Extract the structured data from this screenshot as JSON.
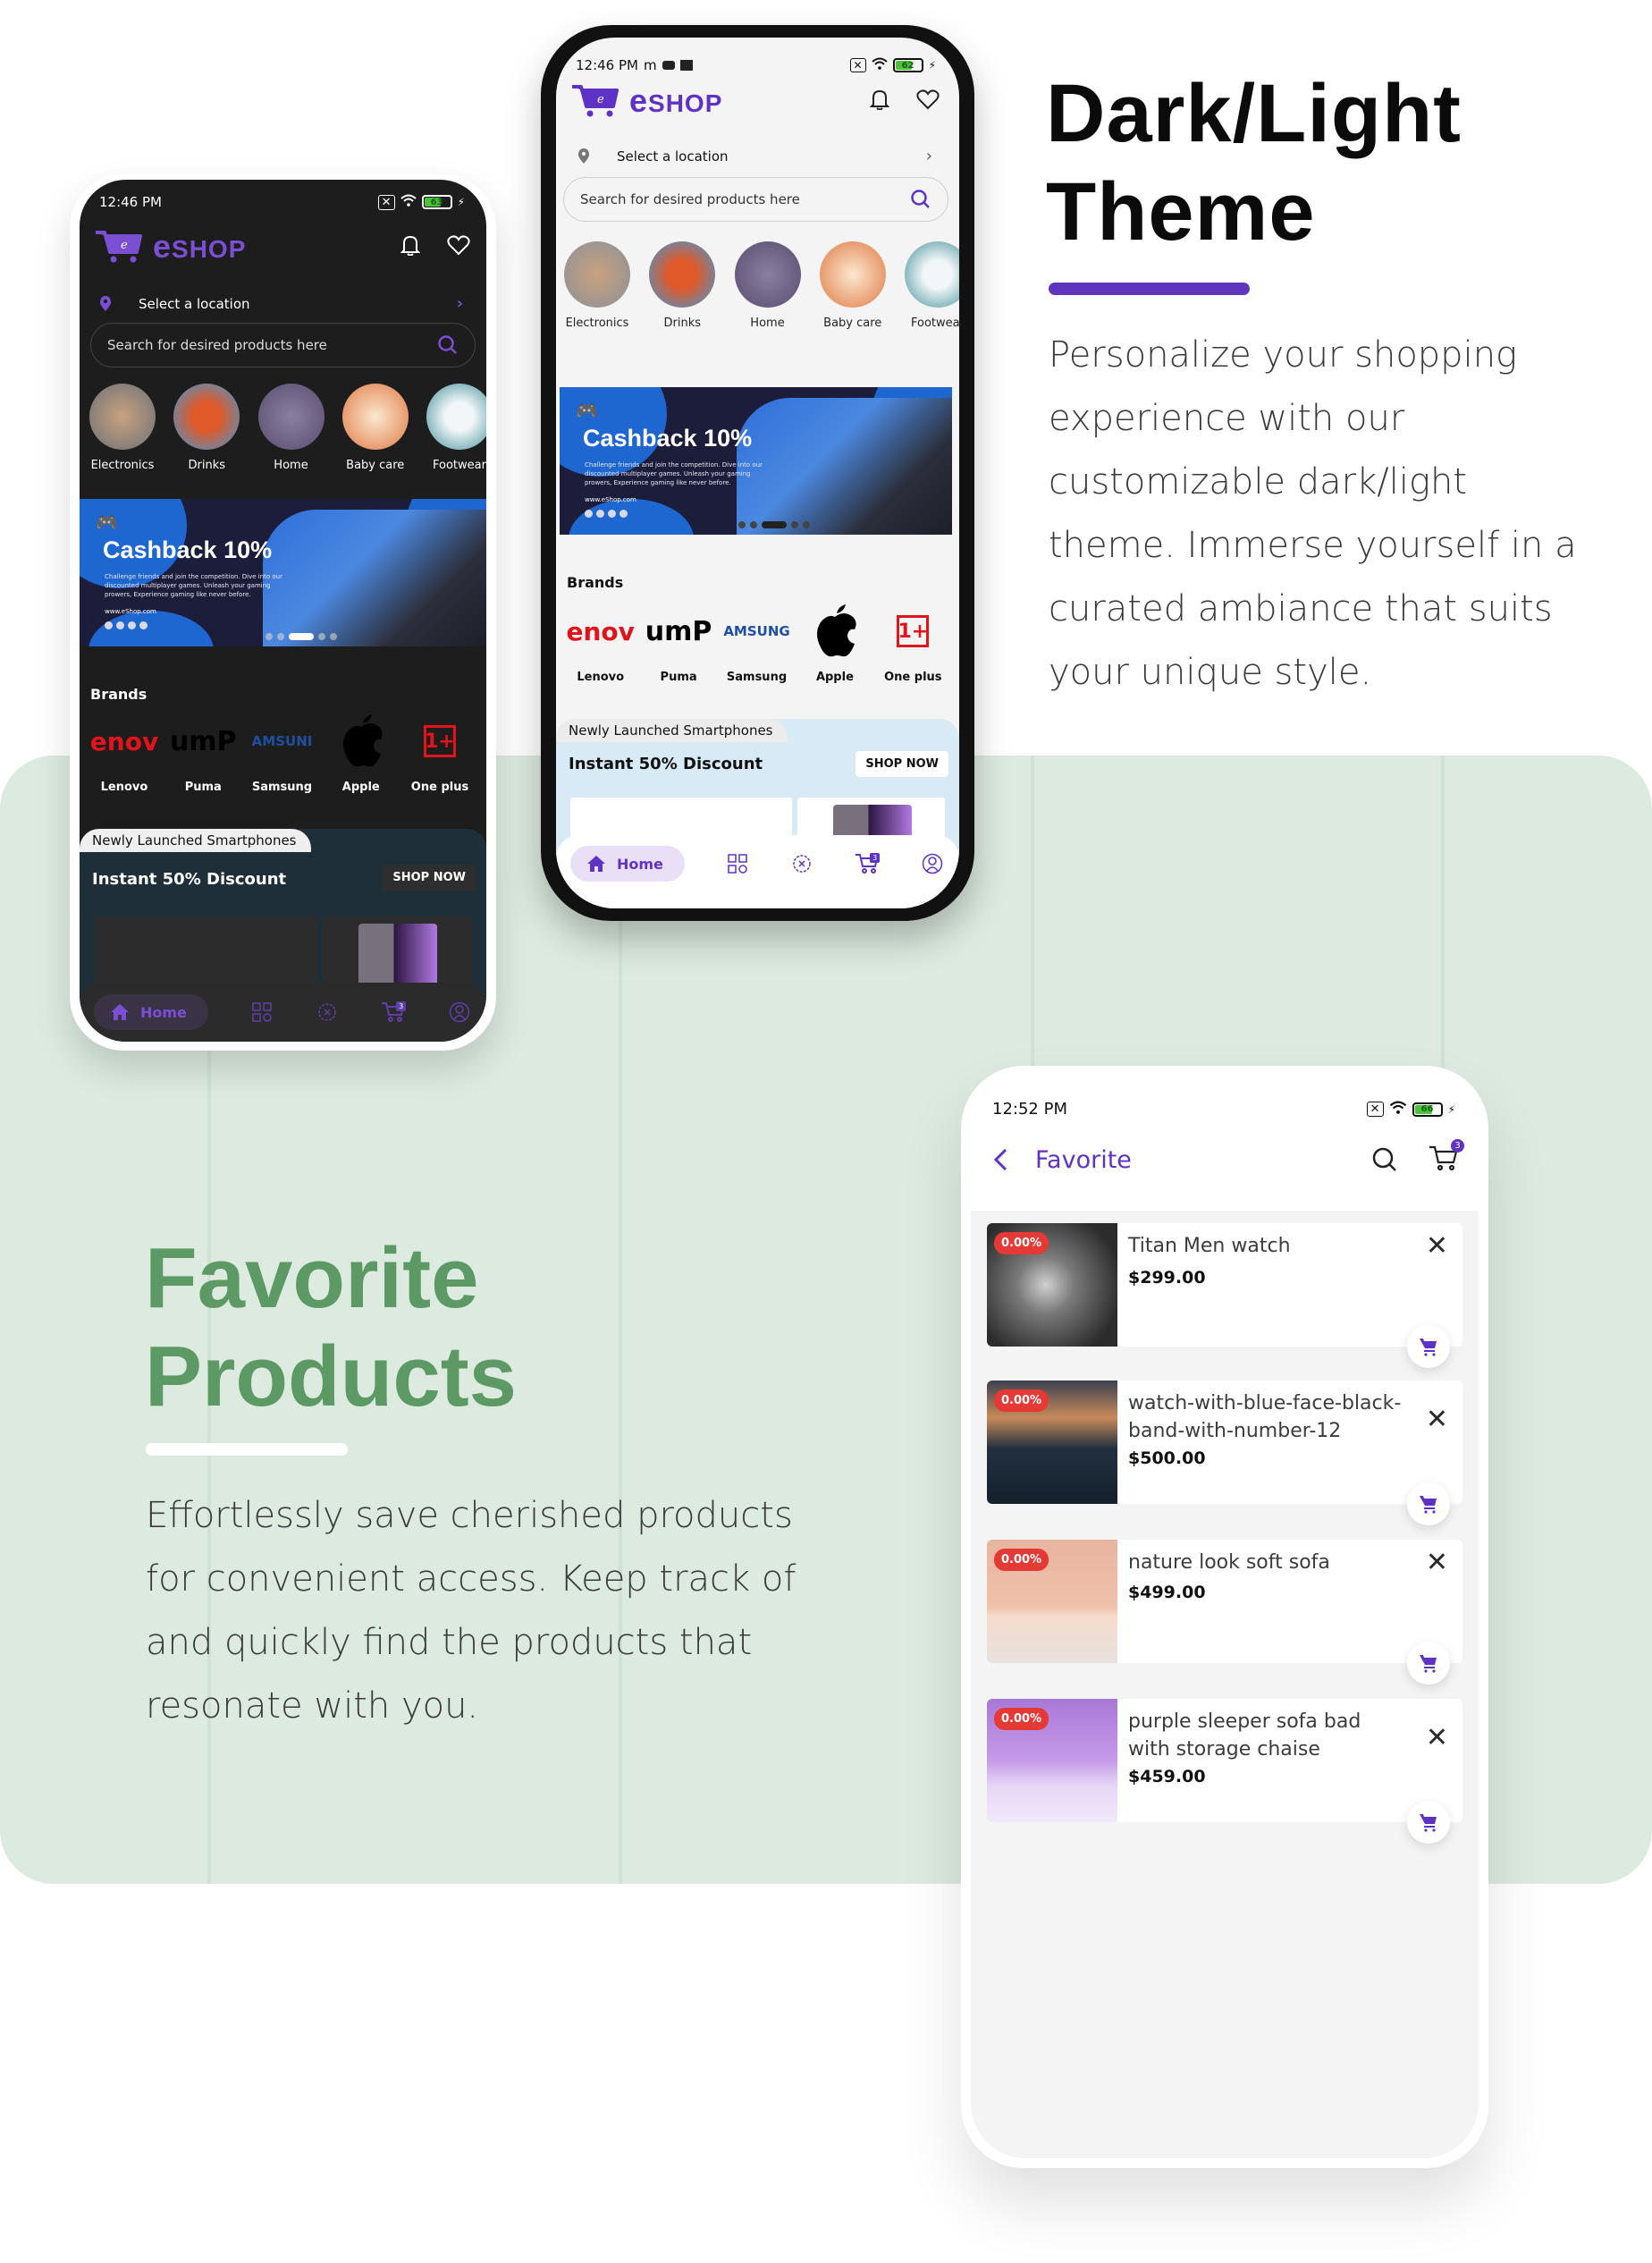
{
  "colors": {
    "accent": "#6b3fd2",
    "accent_bar": "#6035bd",
    "green_title": "#5c9964",
    "green_panel": "#dceadf",
    "badge_red": "#e53935"
  },
  "hero": {
    "title_line1": "Dark/Light",
    "title_line2": "Theme",
    "description": "Personalize your shopping experience with our customizable dark/light theme. Immerse yourself in a curated ambiance that suits your unique style."
  },
  "favorite_section": {
    "title_line1": "Favorite",
    "title_line2": "Products",
    "description": "Effortlessly save cherished products for convenient access. Keep track of and quickly find the products that resonate with you."
  },
  "dark_phone": {
    "time": "12:46 PM",
    "battery": "63",
    "battery_level_pct": 63,
    "app_name_first": "e",
    "app_name_rest": "Shop",
    "location_label": "Select a location",
    "search_placeholder": "Search for desired products here",
    "categories": [
      {
        "label": "Electronics"
      },
      {
        "label": "Drinks"
      },
      {
        "label": "Home"
      },
      {
        "label": "Baby care"
      },
      {
        "label": "Footwear"
      }
    ],
    "banner": {
      "brand": "gamestick",
      "title": "Cashback 10%",
      "description": "Challenge friends and join the competition. Dive into our discounted multiplayer games. Unleash your gaming prowers, Experience gaming like never before.",
      "url": "www.eShop.com",
      "active_slide": 3,
      "slide_count": 5
    },
    "brands_title": "Brands",
    "brands": [
      {
        "label": "Lenovo",
        "logo_text": "enov"
      },
      {
        "label": "Puma",
        "logo_text": "umP"
      },
      {
        "label": "Samsung",
        "logo_text": "AMSUNI"
      },
      {
        "label": "Apple",
        "logo_text": ""
      },
      {
        "label": "One plus",
        "logo_text": "1+"
      }
    ],
    "promo": {
      "tag": "Newly Launched Smartphones",
      "title": "Instant 50% Discount",
      "button": "SHOP NOW"
    },
    "nav": {
      "home_label": "Home",
      "cart_count": "3"
    }
  },
  "light_phone": {
    "time": "12:46 PM",
    "battery": "62",
    "battery_level_pct": 62,
    "app_name_first": "e",
    "app_name_rest": "Shop",
    "location_label": "Select a location",
    "search_placeholder": "Search for desired products here",
    "categories": [
      {
        "label": "Electronics"
      },
      {
        "label": "Drinks"
      },
      {
        "label": "Home"
      },
      {
        "label": "Baby care"
      },
      {
        "label": "Footwear"
      }
    ],
    "banner": {
      "brand": "gamestick",
      "title": "Cashback 10%",
      "description": "Challenge friends and join the competition. Dive into our discounted multiplayer games. Unleash your gaming prowers, Experience gaming like never before.",
      "url": "www.eShop.com",
      "active_slide": 3,
      "slide_count": 5
    },
    "brands_title": "Brands",
    "brands": [
      {
        "label": "Lenovo",
        "logo_text": "enov"
      },
      {
        "label": "Puma",
        "logo_text": "umP"
      },
      {
        "label": "Samsung",
        "logo_text": "AMSUNG"
      },
      {
        "label": "Apple",
        "logo_text": ""
      },
      {
        "label": "One plus",
        "logo_text": "1+"
      }
    ],
    "promo": {
      "tag": "Newly Launched Smartphones",
      "title": "Instant 50% Discount",
      "button": "SHOP NOW"
    },
    "nav": {
      "home_label": "Home",
      "cart_count": "3"
    }
  },
  "fav_phone": {
    "time": "12:52 PM",
    "battery": "66",
    "battery_level_pct": 66,
    "page_title": "Favorite",
    "cart_count": "3",
    "items": [
      {
        "name": "Titan Men watch",
        "price": "$299.00",
        "discount": "0.00%"
      },
      {
        "name": "watch-with-blue-face-black-band-with-number-12",
        "price": "$500.00",
        "discount": "0.00%"
      },
      {
        "name": "nature look soft sofa",
        "price": "$499.00",
        "discount": "0.00%"
      },
      {
        "name": "purple sleeper sofa bad with storage chaise",
        "price": "$459.00",
        "discount": "0.00%"
      }
    ]
  }
}
